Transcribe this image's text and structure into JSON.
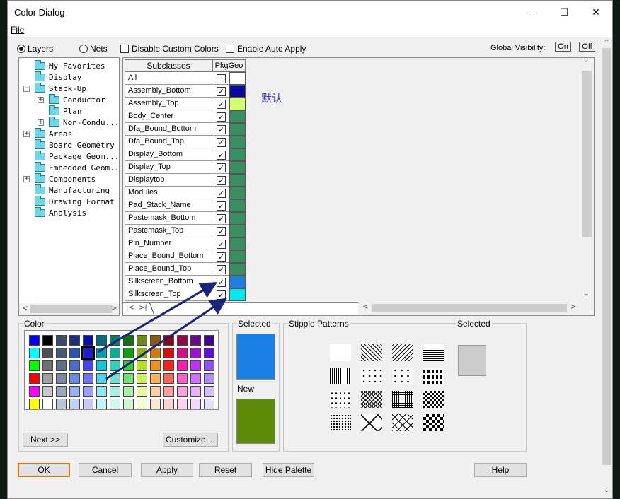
{
  "window": {
    "title": "Color Dialog",
    "minimize": "—",
    "maximize": "☐",
    "close": "✕"
  },
  "menu": {
    "file": "File"
  },
  "mode": {
    "layers": "Layers",
    "nets": "Nets",
    "selected": "layers"
  },
  "options": {
    "disable_custom": "Disable Custom Colors",
    "auto_apply": "Enable Auto Apply"
  },
  "global_visibility": {
    "label": "Global Visibility:",
    "on": "On",
    "off": "Off"
  },
  "tree": [
    {
      "label": "My Favorites",
      "depth": 0,
      "expander": ""
    },
    {
      "label": "Display",
      "depth": 0,
      "expander": ""
    },
    {
      "label": "Stack-Up",
      "depth": 0,
      "expander": "−"
    },
    {
      "label": "Conductor",
      "depth": 1,
      "expander": "+"
    },
    {
      "label": "Plan",
      "depth": 1,
      "expander": ""
    },
    {
      "label": "Non-Condu...",
      "depth": 1,
      "expander": "+"
    },
    {
      "label": "Areas",
      "depth": 0,
      "expander": "+"
    },
    {
      "label": "Board Geometry",
      "depth": 0,
      "expander": ""
    },
    {
      "label": "Package Geom...",
      "depth": 0,
      "expander": ""
    },
    {
      "label": "Embedded Geom...",
      "depth": 0,
      "expander": ""
    },
    {
      "label": "Components",
      "depth": 0,
      "expander": "+"
    },
    {
      "label": "Manufacturing",
      "depth": 0,
      "expander": ""
    },
    {
      "label": "Drawing Format",
      "depth": 0,
      "expander": ""
    },
    {
      "label": "Analysis",
      "depth": 0,
      "expander": ""
    }
  ],
  "grid": {
    "subclasses_header": "Subclasses",
    "column_header": "PkgGeo",
    "annotation": "默认",
    "rows": [
      {
        "name": "All",
        "checked": false,
        "color": "#ffffff"
      },
      {
        "name": "Assembly_Bottom",
        "checked": true,
        "color": "#0a0a9a"
      },
      {
        "name": "Assembly_Top",
        "checked": true,
        "color": "#d4ff6e"
      },
      {
        "name": "Body_Center",
        "checked": true,
        "color": "#3a8f62"
      },
      {
        "name": "Dfa_Bound_Bottom",
        "checked": true,
        "color": "#3a8f62"
      },
      {
        "name": "Dfa_Bound_Top",
        "checked": true,
        "color": "#3a8f62"
      },
      {
        "name": "Display_Bottom",
        "checked": true,
        "color": "#3a8f62"
      },
      {
        "name": "Display_Top",
        "checked": true,
        "color": "#3a8f62"
      },
      {
        "name": "Displaytop",
        "checked": true,
        "color": "#3a8f62"
      },
      {
        "name": "Modules",
        "checked": true,
        "color": "#3a8f62"
      },
      {
        "name": "Pad_Stack_Name",
        "checked": true,
        "color": "#3a8f62"
      },
      {
        "name": "Pastemask_Bottom",
        "checked": true,
        "color": "#3a8f62"
      },
      {
        "name": "Pastemask_Top",
        "checked": true,
        "color": "#3a8f62"
      },
      {
        "name": "Pin_Number",
        "checked": true,
        "color": "#3a8f62"
      },
      {
        "name": "Place_Bound_Bottom",
        "checked": true,
        "color": "#3a8f62"
      },
      {
        "name": "Place_Bound_Top",
        "checked": true,
        "color": "#3a8f62"
      },
      {
        "name": "Silkscreen_Bottom",
        "checked": true,
        "color": "#1e7fe0"
      },
      {
        "name": "Silkscreen_Top",
        "checked": true,
        "color": "#00e8f0"
      }
    ]
  },
  "color_panel": {
    "title": "Color",
    "rows": [
      [
        "#0000ff",
        "#000000",
        "#3c4a66",
        "#1c2f7a",
        "#0c0ca6",
        "#006e7a",
        "#0f7d66",
        "#10700f",
        "#6c8a1c",
        "#8a5a14",
        "#8a0a0a",
        "#8a0a4a",
        "#6a0a8a",
        "#3a0a8a"
      ],
      [
        "#00ffff",
        "#505050",
        "#465a78",
        "#2e52b0",
        "#1b1bd8",
        "#00a0b0",
        "#10aa90",
        "#10a010",
        "#90b810",
        "#d07a10",
        "#d01010",
        "#d0108a",
        "#a010d0",
        "#6010d0"
      ],
      [
        "#00ff00",
        "#707070",
        "#5c6e8c",
        "#4a6ed0",
        "#4444ff",
        "#10c8d8",
        "#30d0b8",
        "#30d030",
        "#b8e020",
        "#f09020",
        "#ff2020",
        "#ff20b0",
        "#c030ff",
        "#9050ff"
      ],
      [
        "#ff0000",
        "#a0a0a0",
        "#7888a6",
        "#6c8ae0",
        "#7070ff",
        "#50d8e8",
        "#70e0c8",
        "#70e070",
        "#d0f060",
        "#f8b060",
        "#ff6060",
        "#ff60c8",
        "#d070ff",
        "#b090ff"
      ],
      [
        "#ff00ff",
        "#c8c8c8",
        "#98a6c0",
        "#98b0f0",
        "#a0a0ff",
        "#90e8f0",
        "#a8f0e0",
        "#a8f0a8",
        "#e8f8a0",
        "#fcd0a0",
        "#ffa0a0",
        "#ffa0e0",
        "#e8b0ff",
        "#d0c0ff"
      ],
      [
        "#ffff00",
        "#ffffff",
        "#b8c4d8",
        "#c0d0f8",
        "#c8c8ff",
        "#c0f4f8",
        "#d0f8f0",
        "#d0f8d0",
        "#f4fcd0",
        "#fee8d0",
        "#ffd0d0",
        "#ffd0f0",
        "#f4d8ff",
        "#e8e0ff"
      ]
    ],
    "selected_row": 1,
    "selected_col": 4,
    "next_button": "Next >>",
    "customize_button": "Customize ..."
  },
  "selected_panel": {
    "title": "Selected",
    "selected_color": "#1a80e6",
    "new_label": "New",
    "new_color": "#5e8a0a"
  },
  "stipple": {
    "title": "Stipple Patterns",
    "selected_label": "Selected",
    "selected_color": "#cccccc",
    "patterns": [
      "solid-white",
      "diag-back",
      "diag-fwd",
      "horiz",
      "vert",
      "dots-tri",
      "plus",
      "dash",
      "dots-sparse",
      "cross-diag",
      "grid",
      "checker",
      "dots-dense",
      "diamond",
      "wave",
      "big-checker"
    ]
  },
  "buttons": {
    "ok": "OK",
    "cancel": "Cancel",
    "apply": "Apply",
    "reset": "Reset",
    "hide_palette": "Hide Palette",
    "help": "Help"
  }
}
